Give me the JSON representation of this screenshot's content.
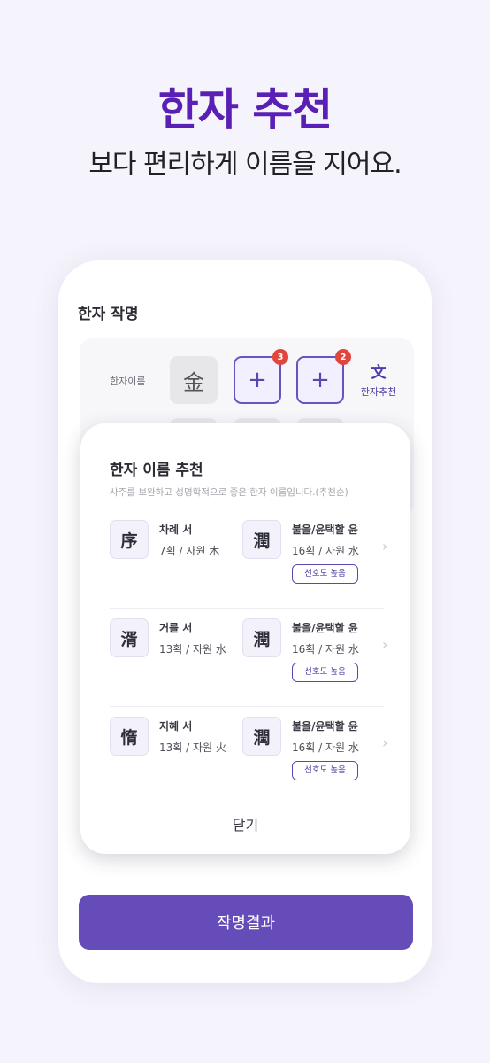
{
  "hero": {
    "title": "한자 추천",
    "subtitle": "보다 편리하게 이름을 지어요."
  },
  "screen": {
    "title": "한자 작명",
    "name_row_label": "한자이름",
    "filled_char": "金",
    "add_symbol": "+",
    "slot_badges": [
      "3",
      "2"
    ],
    "recommend_icon": "文",
    "recommend_label": "한자추천"
  },
  "modal": {
    "title": "한자 이름 추천",
    "description": "사주를 보완하고 성명학적으로 좋은 한자 이름입니다.(추천순)",
    "rows": [
      {
        "first": {
          "char": "序",
          "name": "차례 서",
          "stats": "7획 / 자원 木"
        },
        "second": {
          "char": "潤",
          "name": "불을/윤택할 윤",
          "stats": "16획 / 자원 水"
        },
        "badge": "선호도 높음"
      },
      {
        "first": {
          "char": "湑",
          "name": "거를 서",
          "stats": "13획 / 자원 水"
        },
        "second": {
          "char": "潤",
          "name": "불을/윤택할 윤",
          "stats": "16획 / 자원 水"
        },
        "badge": "선호도 높음"
      },
      {
        "first": {
          "char": "惰",
          "name": "지혜 서",
          "stats": "13획 / 자원 火"
        },
        "second": {
          "char": "潤",
          "name": "불을/윤택할 윤",
          "stats": "16획 / 자원 水"
        },
        "badge": "선호도 높음"
      }
    ],
    "close_label": "닫기"
  },
  "cta": {
    "label": "작명결과"
  },
  "colors": {
    "accent": "#654cb8",
    "hero_title": "#5a1fb5",
    "badge_red": "#e2453c"
  }
}
